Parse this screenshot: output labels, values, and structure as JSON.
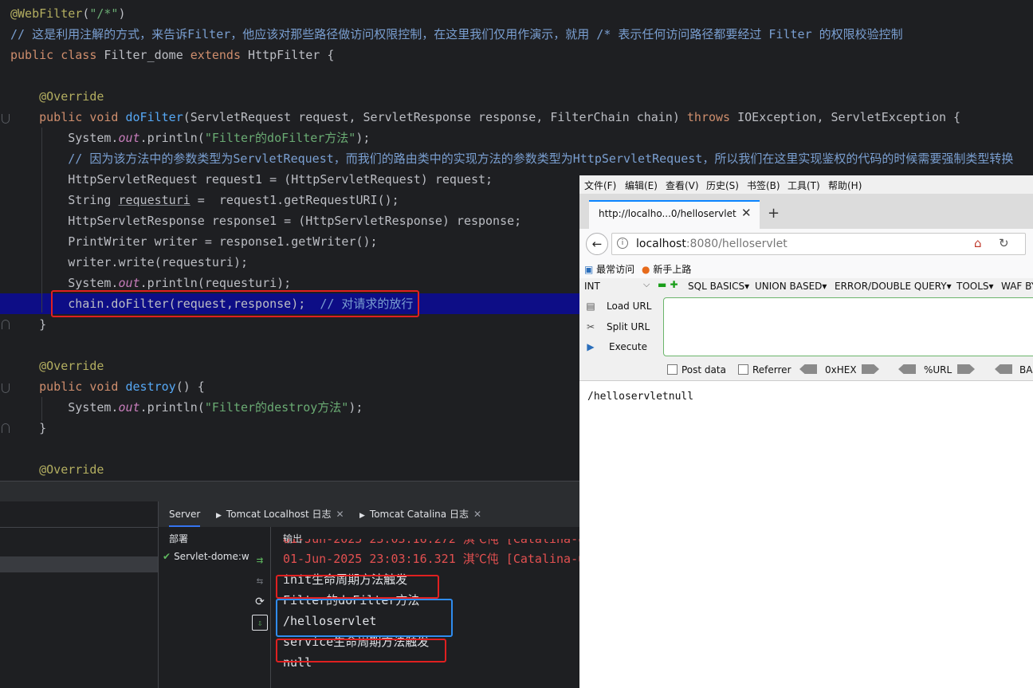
{
  "editor": {
    "lines": [
      {
        "tokens": [
          {
            "c": "ann",
            "t": "@WebFilter"
          },
          {
            "c": "plain",
            "t": "("
          },
          {
            "c": "str",
            "t": "\"/*\""
          },
          {
            "c": "plain",
            "t": ")"
          }
        ]
      },
      {
        "tokens": [
          {
            "c": "cmt",
            "t": "// 这是利用注解的方式，来告诉Filter，他应该对那些路径做访问权限控制，在这里我们仅用作演示，就用 /* 表示任何访问路径都要经过 Filter 的权限校验控制"
          }
        ]
      },
      {
        "tokens": [
          {
            "c": "kw",
            "t": "public class "
          },
          {
            "c": "plain",
            "t": "Filter_dome "
          },
          {
            "c": "kw",
            "t": "extends "
          },
          {
            "c": "plain",
            "t": "HttpFilter {"
          }
        ]
      },
      {
        "tokens": []
      },
      {
        "tokens": [
          {
            "c": "ann",
            "t": "    @Override"
          }
        ]
      },
      {
        "tokens": [
          {
            "c": "kw",
            "t": "    public void "
          },
          {
            "c": "fn",
            "t": "doFilter"
          },
          {
            "c": "plain",
            "t": "(ServletRequest request, ServletResponse response, FilterChain chain) "
          },
          {
            "c": "kw",
            "t": "throws "
          },
          {
            "c": "plain",
            "t": "IOException, ServletException {"
          }
        ]
      },
      {
        "tokens": [
          {
            "c": "plain",
            "t": "        System."
          },
          {
            "c": "fld",
            "t": "out"
          },
          {
            "c": "plain",
            "t": ".println("
          },
          {
            "c": "str",
            "t": "\"Filter的doFilter方法\""
          },
          {
            "c": "plain",
            "t": ");"
          }
        ]
      },
      {
        "tokens": [
          {
            "c": "cmt",
            "t": "        // 因为该方法中的参数类型为ServletRequest，而我们的路由类中的实现方法的参数类型为HttpServletRequest，所以我们在这里实现鉴权的代码的时候需要强制类型转换"
          }
        ]
      },
      {
        "tokens": [
          {
            "c": "plain",
            "t": "        HttpServletRequest request1 = (HttpServletRequest) request;"
          }
        ]
      },
      {
        "tokens": [
          {
            "c": "plain",
            "t": "        String "
          },
          {
            "c": "plain ul",
            "t": "requesturi"
          },
          {
            "c": "plain",
            "t": " =  request1.getRequestURI();"
          }
        ]
      },
      {
        "tokens": [
          {
            "c": "plain",
            "t": "        HttpServletResponse response1 = (HttpServletResponse) response;"
          }
        ]
      },
      {
        "tokens": [
          {
            "c": "plain",
            "t": "        PrintWriter writer = response1.getWriter();"
          }
        ]
      },
      {
        "tokens": [
          {
            "c": "plain",
            "t": "        writer.write(requesturi);"
          }
        ]
      },
      {
        "tokens": [
          {
            "c": "plain",
            "t": "        System."
          },
          {
            "c": "fld",
            "t": "out"
          },
          {
            "c": "plain",
            "t": ".println(requesturi);"
          }
        ]
      },
      {
        "tokens": [
          {
            "c": "plain",
            "t": "        chain.doFilter(request,response);  "
          },
          {
            "c": "cmt",
            "t": "// 对请求的放行"
          }
        ]
      },
      {
        "tokens": [
          {
            "c": "plain",
            "t": "    }"
          }
        ]
      },
      {
        "tokens": []
      },
      {
        "tokens": [
          {
            "c": "ann",
            "t": "    @Override"
          }
        ]
      },
      {
        "tokens": [
          {
            "c": "kw",
            "t": "    public void "
          },
          {
            "c": "fn",
            "t": "destroy"
          },
          {
            "c": "plain",
            "t": "() {"
          }
        ]
      },
      {
        "tokens": [
          {
            "c": "plain",
            "t": "        System."
          },
          {
            "c": "fld",
            "t": "out"
          },
          {
            "c": "plain",
            "t": ".println("
          },
          {
            "c": "str",
            "t": "\"Filter的destroy方法\""
          },
          {
            "c": "plain",
            "t": ");"
          }
        ]
      },
      {
        "tokens": [
          {
            "c": "plain",
            "t": "    }"
          }
        ]
      },
      {
        "tokens": []
      },
      {
        "tokens": [
          {
            "c": "ann",
            "t": "    @Override"
          }
        ]
      }
    ]
  },
  "services": {
    "tabs": [
      {
        "label": "Server",
        "active": true
      },
      {
        "label": "Tomcat Localhost 日志",
        "active": false
      },
      {
        "label": "Tomcat Catalina 日志",
        "active": false
      }
    ],
    "deploy_header": "部署",
    "output_header": "输出",
    "deploy_item": "Servlet-dome:w",
    "output_lines": [
      {
        "text": "01-Jun-2025 23:03:16.272 淇℃伅 [Catalina-u",
        "style": "out-red"
      },
      {
        "text": "01-Jun-2025 23:03:16.321 淇℃伅 [Catalina-u",
        "style": "out-red"
      },
      {
        "text": "init生命周期方法触发",
        "style": "out-white"
      },
      {
        "text": "Filter的doFilter方法",
        "style": "out-white"
      },
      {
        "text": "/helloservlet",
        "style": "out-white"
      },
      {
        "text": "service生命周期方法触发",
        "style": "out-white"
      },
      {
        "text": "null",
        "style": "out-white"
      }
    ],
    "box_colors": {
      "red": "#e02020",
      "blue": "#2f8cf0"
    }
  },
  "browser": {
    "menu": [
      "文件(F)",
      "编辑(E)",
      "查看(V)",
      "历史(S)",
      "书签(B)",
      "工具(T)",
      "帮助(H)"
    ],
    "tab_title": "http://localho...0/helloservlet",
    "url_host": "localhost",
    "url_rest": ":8080/helloservlet",
    "bookmarks": [
      "最常访问",
      "新手上路"
    ],
    "hackbar": {
      "select_value": "INT",
      "menus": [
        "SQL BASICS▾",
        "UNION BASED▾",
        "ERROR/DOUBLE QUERY▾",
        "TOOLS▾",
        "WAF BY"
      ],
      "buttons": [
        "Load URL",
        "Split URL",
        "Execute"
      ],
      "checks": [
        "Post data",
        "Referrer"
      ],
      "encoders": [
        "0xHEX",
        "%URL",
        "BA"
      ]
    },
    "page_text": "/helloservletnull"
  }
}
